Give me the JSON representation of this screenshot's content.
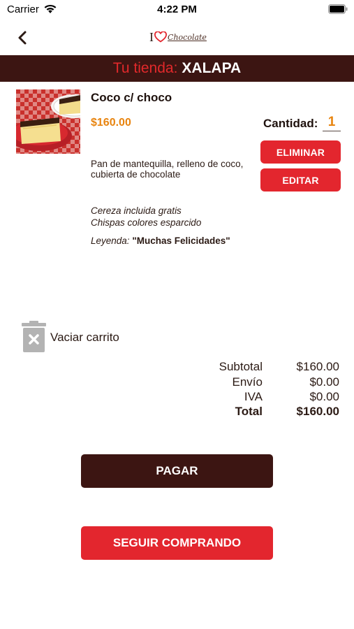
{
  "status_bar": {
    "carrier": "Carrier",
    "time": "4:22 PM",
    "icons": [
      "wifi-icon",
      "battery-icon"
    ]
  },
  "nav": {
    "back_icon": "chevron-left-icon",
    "logo": {
      "letter": "I",
      "heart_icon": "heart-icon",
      "word": "Chocolate"
    }
  },
  "store": {
    "label": "Tu tienda:",
    "name": "XALAPA"
  },
  "cart_item": {
    "name": "Coco c/ choco",
    "price": "$160.00",
    "quantity_label": "Cantidad:",
    "quantity": "1",
    "description": "Pan de mantequilla, relleno de coco, cubierta de chocolate",
    "extras": [
      "Cereza incluida gratis",
      "Chispas colores esparcido"
    ],
    "legend_label": "Leyenda:",
    "legend_value": "\"Muchas Felicidades\"",
    "remove_label": "ELIMINAR",
    "edit_label": "EDITAR"
  },
  "clear_cart": {
    "icon": "trash-icon",
    "label": "Vaciar carrito"
  },
  "totals": {
    "subtotal_label": "Subtotal",
    "subtotal": "$160.00",
    "shipping_label": "Envío",
    "shipping": "$0.00",
    "tax_label": "IVA",
    "tax": "$0.00",
    "total_label": "Total",
    "total": "$160.00"
  },
  "actions": {
    "pay_label": "PAGAR",
    "continue_label": "SEGUIR COMPRANDO"
  },
  "colors": {
    "brand_dark": "#3c1512",
    "brand_red": "#e3262e",
    "price_orange": "#e8840f"
  }
}
